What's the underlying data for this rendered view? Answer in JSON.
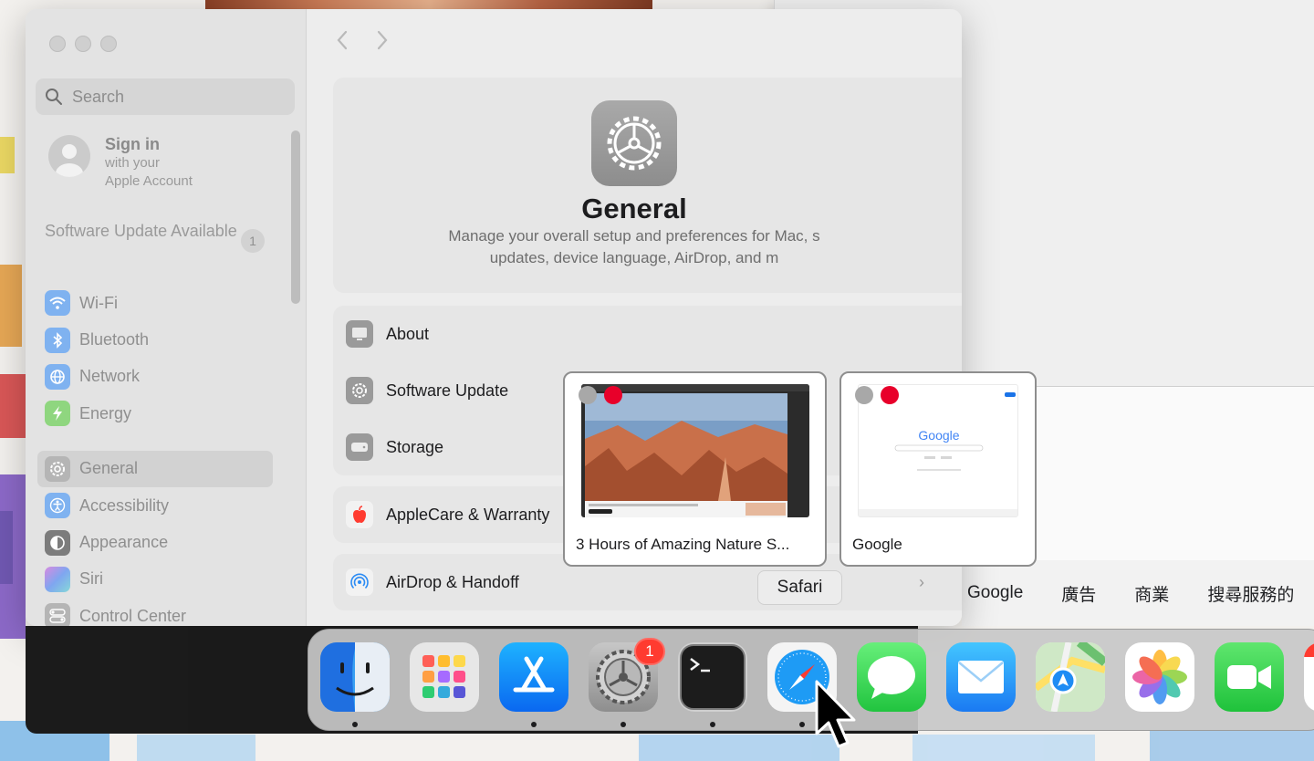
{
  "colors": {
    "accent_blue": "#0a7aff",
    "badge_red": "#ff3b30",
    "sidebar_bg": "#e3e3e3",
    "content_bg": "#ededed"
  },
  "sidebar": {
    "search_placeholder": "Search",
    "account": {
      "title": "Sign in",
      "line1": "with your",
      "line2": "Apple Account"
    },
    "update": {
      "label": "Software Update Available",
      "count": "1"
    },
    "items": [
      {
        "label": "Wi-Fi",
        "icon": "wifi-icon"
      },
      {
        "label": "Bluetooth",
        "icon": "bluetooth-icon"
      },
      {
        "label": "Network",
        "icon": "network-icon"
      },
      {
        "label": "Energy",
        "icon": "energy-icon"
      },
      {
        "label": "General",
        "icon": "gear-icon",
        "selected": true
      },
      {
        "label": "Accessibility",
        "icon": "accessibility-icon"
      },
      {
        "label": "Appearance",
        "icon": "appearance-icon"
      },
      {
        "label": "Siri",
        "icon": "siri-icon"
      },
      {
        "label": "Control Center",
        "icon": "control-center-icon"
      }
    ]
  },
  "main": {
    "title": "General",
    "description_line1": "Manage your overall setup and preferences for Mac, s",
    "description_line2": "updates, device language, AirDrop, and m",
    "rows": [
      {
        "label": "About",
        "icon": "display-icon"
      },
      {
        "label": "Software Update",
        "icon": "gear-badge-icon"
      },
      {
        "label": "Storage",
        "icon": "storage-icon"
      },
      {
        "label": "AppleCare & Warranty",
        "icon": "apple-icon"
      },
      {
        "label": "AirDrop & Handoff",
        "icon": "airdrop-icon"
      }
    ]
  },
  "windows": [
    {
      "label": "3 Hours of Amazing Nature S..."
    },
    {
      "label": "Google",
      "logo_text": "Google"
    }
  ],
  "google_bar": {
    "items": [
      "Google",
      "廣告",
      "商業",
      "搜尋服務的"
    ]
  },
  "tooltip": "Safari",
  "dock": {
    "apps": [
      {
        "name": "Finder",
        "icon": "finder-icon",
        "running": true
      },
      {
        "name": "Launchpad",
        "icon": "launchpad-icon",
        "running": false
      },
      {
        "name": "App Store",
        "icon": "app-store-icon",
        "running": true
      },
      {
        "name": "System Settings",
        "icon": "system-settings-icon",
        "running": true,
        "badge": "1"
      },
      {
        "name": "Terminal",
        "icon": "terminal-icon",
        "running": true
      },
      {
        "name": "Safari",
        "icon": "safari-icon",
        "running": true
      },
      {
        "name": "Messages",
        "icon": "messages-icon",
        "running": false
      },
      {
        "name": "Mail",
        "icon": "mail-icon",
        "running": false
      },
      {
        "name": "Maps",
        "icon": "maps-icon",
        "running": false
      },
      {
        "name": "Photos",
        "icon": "photos-icon",
        "running": false
      },
      {
        "name": "FaceTime",
        "icon": "facetime-icon",
        "running": false
      }
    ]
  }
}
